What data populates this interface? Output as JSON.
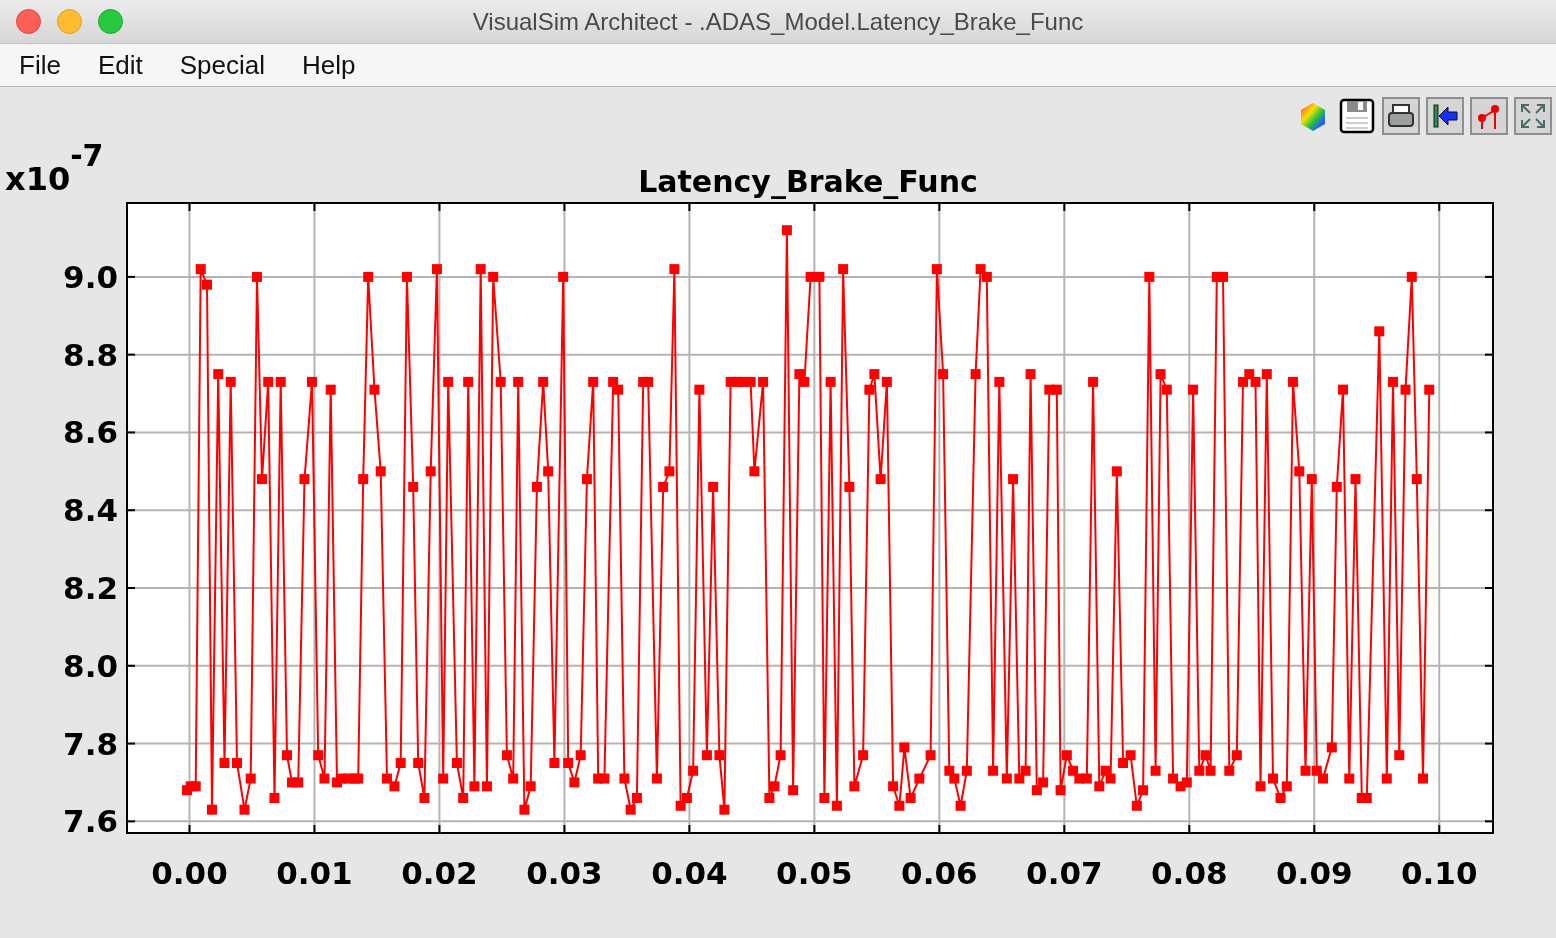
{
  "window": {
    "title": "VisualSim Architect - .ADAS_Model.Latency_Brake_Func"
  },
  "menu": [
    {
      "label": "File"
    },
    {
      "label": "Edit"
    },
    {
      "label": "Special"
    },
    {
      "label": "Help"
    }
  ],
  "plot": {
    "scale_base": "x10",
    "scale_exponent": "-7",
    "chart_data": {
      "type": "line",
      "grid": true,
      "title": "Latency_Brake_Func",
      "xlim": [
        -0.005,
        0.1043
      ],
      "ylim": [
        7.57,
        9.19
      ],
      "xticks": [
        {
          "value": 0,
          "label": "0.00"
        },
        {
          "value": 0.01,
          "label": "0.01"
        },
        {
          "value": 0.02,
          "label": "0.02"
        },
        {
          "value": 0.03,
          "label": "0.03"
        },
        {
          "value": 0.04,
          "label": "0.04"
        },
        {
          "value": 0.05,
          "label": "0.05"
        },
        {
          "value": 0.06,
          "label": "0.06"
        },
        {
          "value": 0.07,
          "label": "0.07"
        },
        {
          "value": 0.08,
          "label": "0.08"
        },
        {
          "value": 0.09,
          "label": "0.09"
        },
        {
          "value": 0.1,
          "label": "0.10"
        }
      ],
      "yticks": [
        {
          "value": 7.6,
          "label": "7.6"
        },
        {
          "value": 7.8,
          "label": "7.8"
        },
        {
          "value": 8.0,
          "label": "8.0"
        },
        {
          "value": 8.2,
          "label": "8.2"
        },
        {
          "value": 8.4,
          "label": "8.4"
        },
        {
          "value": 8.6,
          "label": "8.6"
        },
        {
          "value": 8.8,
          "label": "8.8"
        },
        {
          "value": 9.0,
          "label": "9.0"
        }
      ],
      "x": [
        -0.0002,
        0.0001,
        0.0005,
        0.0009,
        0.0014,
        0.0018,
        0.0023,
        0.0028,
        0.0033,
        0.0038,
        0.0044,
        0.0049,
        0.0054,
        0.0058,
        0.0063,
        0.0068,
        0.0073,
        0.0078,
        0.0082,
        0.0087,
        0.0092,
        0.0098,
        0.0103,
        0.0108,
        0.0113,
        0.0118,
        0.0122,
        0.0127,
        0.0132,
        0.0135,
        0.0139,
        0.0143,
        0.0148,
        0.0153,
        0.0158,
        0.0164,
        0.0169,
        0.0174,
        0.0179,
        0.0183,
        0.0188,
        0.0193,
        0.0198,
        0.0203,
        0.0207,
        0.0214,
        0.0219,
        0.0223,
        0.0228,
        0.0233,
        0.0238,
        0.0243,
        0.0249,
        0.0254,
        0.0259,
        0.0263,
        0.0268,
        0.0273,
        0.0278,
        0.0283,
        0.0287,
        0.0292,
        0.0299,
        0.0303,
        0.0308,
        0.0313,
        0.0318,
        0.0323,
        0.0327,
        0.0332,
        0.0339,
        0.0343,
        0.0348,
        0.0353,
        0.0358,
        0.0363,
        0.0367,
        0.0374,
        0.0379,
        0.0384,
        0.0388,
        0.0393,
        0.0398,
        0.0403,
        0.0408,
        0.0414,
        0.0419,
        0.0424,
        0.0428,
        0.0433,
        0.0438,
        0.0443,
        0.0449,
        0.0452,
        0.0459,
        0.0464,
        0.0468,
        0.0473,
        0.0478,
        0.0483,
        0.0488,
        0.0492,
        0.0497,
        0.0504,
        0.0508,
        0.0513,
        0.0518,
        0.0523,
        0.0528,
        0.0532,
        0.0539,
        0.0544,
        0.0548,
        0.0553,
        0.0558,
        0.0563,
        0.0568,
        0.0572,
        0.0577,
        0.0584,
        0.0593,
        0.0598,
        0.0603,
        0.0608,
        0.0612,
        0.0617,
        0.0622,
        0.0629,
        0.0633,
        0.0638,
        0.0643,
        0.0648,
        0.0654,
        0.0659,
        0.0664,
        0.0669,
        0.0673,
        0.0678,
        0.0683,
        0.0688,
        0.0694,
        0.0697,
        0.0702,
        0.0707,
        0.0712,
        0.0718,
        0.0723,
        0.0728,
        0.0733,
        0.0737,
        0.0742,
        0.0747,
        0.0753,
        0.0758,
        0.0763,
        0.0768,
        0.0773,
        0.0777,
        0.0782,
        0.0787,
        0.0793,
        0.0798,
        0.0803,
        0.0808,
        0.0813,
        0.0817,
        0.0822,
        0.0827,
        0.0832,
        0.0838,
        0.0843,
        0.0848,
        0.0853,
        0.0857,
        0.0862,
        0.0867,
        0.0873,
        0.0878,
        0.0883,
        0.0888,
        0.0893,
        0.0898,
        0.0902,
        0.0907,
        0.0914,
        0.0918,
        0.0923,
        0.0928,
        0.0933,
        0.0938,
        0.0942,
        0.0952,
        0.0958,
        0.0963,
        0.0968,
        0.0973,
        0.0978,
        0.0982,
        0.0987,
        0.0992
      ],
      "series": [
        {
          "color": "#ff0000",
          "marker": "square",
          "values": [
            7.68,
            7.69,
            7.69,
            9.02,
            8.98,
            7.63,
            8.75,
            7.75,
            8.73,
            7.75,
            7.63,
            7.71,
            9.0,
            8.48,
            8.73,
            7.66,
            8.73,
            7.77,
            7.7,
            7.7,
            8.48,
            8.73,
            7.77,
            7.71,
            8.71,
            7.7,
            7.71,
            7.71,
            7.71,
            7.71,
            8.48,
            9.0,
            8.71,
            8.5,
            7.71,
            7.69,
            7.75,
            9.0,
            8.46,
            7.75,
            7.66,
            8.5,
            9.02,
            7.71,
            8.73,
            7.75,
            7.66,
            8.73,
            7.69,
            9.02,
            7.69,
            9.0,
            8.73,
            7.77,
            7.71,
            8.73,
            7.63,
            7.69,
            8.46,
            8.73,
            8.5,
            7.75,
            9.0,
            7.75,
            7.7,
            7.77,
            8.48,
            8.73,
            7.71,
            7.71,
            8.73,
            8.71,
            7.71,
            7.63,
            7.66,
            8.73,
            8.73,
            7.71,
            8.46,
            8.5,
            9.02,
            7.64,
            7.66,
            7.73,
            8.71,
            7.77,
            8.46,
            7.77,
            7.63,
            8.73,
            8.73,
            8.73,
            8.73,
            8.5,
            8.73,
            7.66,
            7.69,
            7.77,
            9.12,
            7.68,
            8.75,
            8.73,
            9.0,
            9.0,
            7.66,
            8.73,
            7.64,
            9.02,
            8.46,
            7.69,
            7.77,
            8.71,
            8.75,
            8.48,
            8.73,
            7.69,
            7.64,
            7.79,
            7.66,
            7.71,
            7.77,
            9.02,
            8.75,
            7.73,
            7.71,
            7.64,
            7.73,
            8.75,
            9.02,
            9.0,
            7.73,
            8.73,
            7.71,
            8.48,
            7.71,
            7.73,
            8.75,
            7.68,
            7.7,
            8.71,
            8.71,
            7.68,
            7.77,
            7.73,
            7.71,
            7.71,
            8.73,
            7.69,
            7.73,
            7.71,
            8.5,
            7.75,
            7.77,
            7.64,
            7.68,
            9.0,
            7.73,
            8.75,
            8.71,
            7.71,
            7.69,
            7.7,
            8.71,
            7.73,
            7.77,
            7.73,
            9.0,
            9.0,
            7.73,
            7.77,
            8.73,
            8.75,
            8.73,
            7.69,
            8.75,
            7.71,
            7.66,
            7.69,
            8.73,
            8.5,
            7.73,
            8.48,
            7.73,
            7.71,
            7.79,
            8.46,
            8.71,
            7.71,
            8.48,
            7.66,
            7.66,
            8.86,
            7.71,
            8.73,
            7.77,
            8.71,
            9.0,
            8.48,
            7.71,
            8.71
          ]
        }
      ]
    }
  }
}
